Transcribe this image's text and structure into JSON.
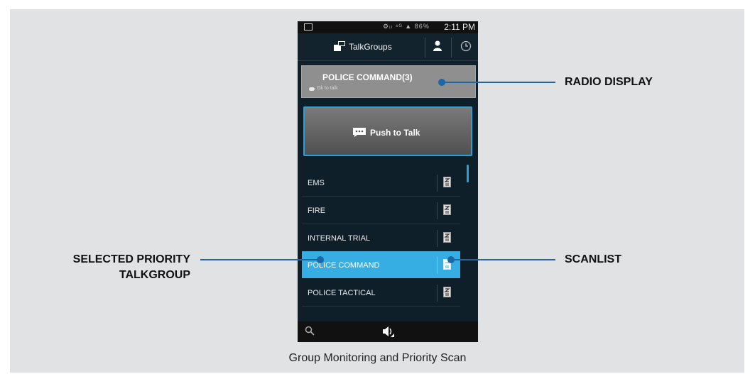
{
  "status_bar": {
    "icons": "⚙ᵢₗ ⁴ᴳ ▲ 86%",
    "time": "2:11 PM"
  },
  "action_bar": {
    "title": "TalkGroups"
  },
  "radio_display": {
    "talkgroup": "POLICE COMMAND(3)",
    "status": "Ok to talk"
  },
  "ptt": {
    "label": "Push to Talk"
  },
  "talkgroups": [
    {
      "name": "EMS",
      "selected": false
    },
    {
      "name": "FIRE",
      "selected": false
    },
    {
      "name": "INTERNAL TRIAL",
      "selected": false
    },
    {
      "name": "POLICE COMMAND",
      "selected": true
    },
    {
      "name": "POLICE TACTICAL",
      "selected": false
    }
  ],
  "callouts": {
    "radio_display": "RADIO DISPLAY",
    "priority_1": "SELECTED PRIORITY",
    "priority_2": "TALKGROUP",
    "scanlist": "SCANLIST"
  },
  "caption": "Group Monitoring and Priority Scan",
  "colors": {
    "accent": "#36aee3",
    "callout_line": "#1d67a8",
    "panel": "#e1e2e4",
    "phone_bg": "#0f1f2a"
  }
}
